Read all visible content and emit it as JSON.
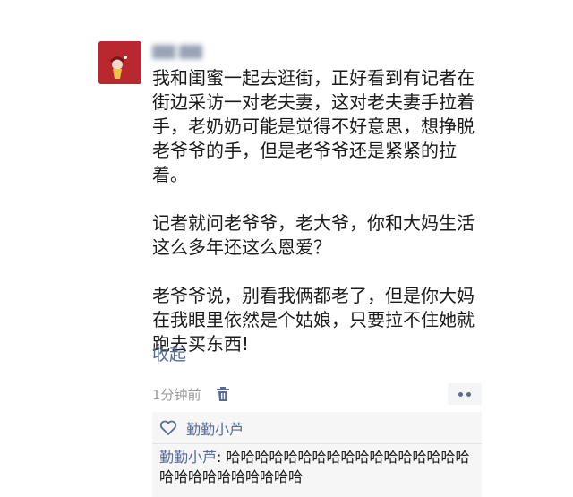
{
  "post": {
    "username": "",
    "paragraphs": [
      "我和闺蜜一起去逛街，正好看到有记者在街边采访一对老夫妻，这对老夫妻手拉着手，老奶奶可能是觉得不好意思，想挣脱老爷爷的手，但是老爷爷还是紧紧的拉着。",
      "记者就问老爷爷，老大爷，你和大妈生活这么多年还这么恩爱？",
      "老爷爷说，别看我俩都老了，但是你大妈在我眼里依然是个姑娘，只要拉不住她就跑去买东西!"
    ],
    "collapse_label": "收起",
    "time": "1分钟前"
  },
  "likes": {
    "names": "勤勤小芦"
  },
  "comments": [
    {
      "author": "勤勤小芦",
      "separator": ": ",
      "text": "哈哈哈哈哈哈哈哈哈哈哈哈哈哈哈哈哈哈哈哈哈哈哈哈哈哈哈"
    }
  ],
  "colors": {
    "link": "#576b95",
    "avatar_bg": "#b8282e"
  },
  "icons": {
    "delete": "trash-icon",
    "like": "heart-outline-icon",
    "more": "more-dots-icon"
  }
}
